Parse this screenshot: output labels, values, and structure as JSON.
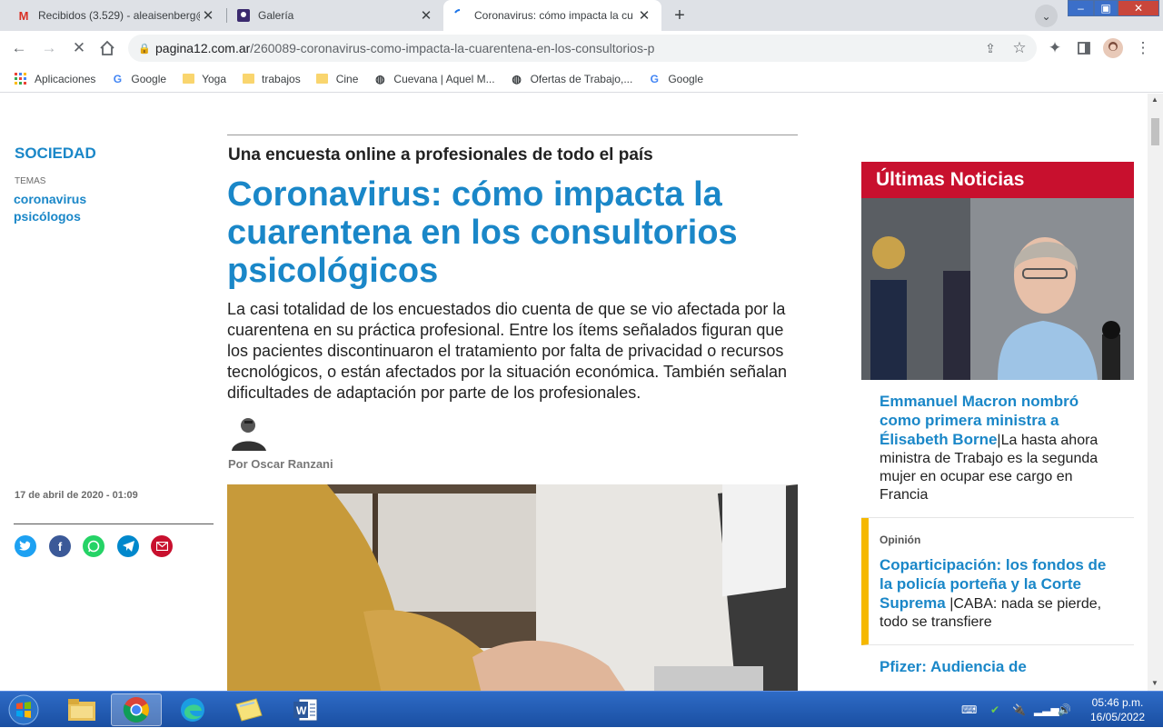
{
  "browser": {
    "tabs": [
      {
        "title": "Recibidos (3.529) - aleaisenberg@",
        "favicon": "gmail-icon"
      },
      {
        "title": "Galería",
        "favicon": "gallery-icon"
      },
      {
        "title": "Coronavirus: cómo impacta la cu",
        "favicon": "loading-icon"
      }
    ],
    "url_host": "pagina12.com.ar",
    "url_path": "/260089-coronavirus-como-impacta-la-cuarentena-en-los-consultorios-p",
    "bookmarks": [
      {
        "label": "Aplicaciones",
        "icon": "apps-grid-icon"
      },
      {
        "label": "Google",
        "icon": "google-icon"
      },
      {
        "label": "Yoga",
        "icon": "folder-icon"
      },
      {
        "label": "trabajos",
        "icon": "folder-icon"
      },
      {
        "label": "Cine",
        "icon": "folder-icon"
      },
      {
        "label": "Cuevana | Aquel M...",
        "icon": "globe-icon"
      },
      {
        "label": "Ofertas de Trabajo,...",
        "icon": "globe-icon"
      },
      {
        "label": "Google",
        "icon": "google-icon"
      }
    ]
  },
  "article": {
    "section": "SOCIEDAD",
    "temas_label": "TEMAS",
    "temas": [
      "coronavirus",
      "psicólogos"
    ],
    "date": "17 de abril de 2020 - 01:09",
    "volanta": "Una encuesta online a profesionales de todo el país",
    "title": "Coronavirus: cómo impacta la cuarentena en los consultorios psicológicos",
    "lead": "La casi totalidad de los encuestados dio cuenta de que se vio afectada por la cuarentena en su práctica profesional. Entre los ítems señalados figuran que los pacientes discontinuaron el tratamiento por falta de privacidad o recursos tecnológicos, o están afectados por la situación económica. También señalan dificultades de adaptación por parte de los profesionales.",
    "author": "Por Oscar Ranzani"
  },
  "sidebar": {
    "heading": "Últimas Noticias",
    "items": [
      {
        "kicker": "",
        "title": "Emmanuel Macron nombró como primera ministra a Élisabeth Borne",
        "sep": "|",
        "desc": "La hasta ahora ministra de Trabajo es la segunda mujer en ocupar ese cargo en Francia"
      },
      {
        "kicker": "Opinión",
        "title": "Coparticipación: los fondos de la policía porteña y la Corte Suprema",
        "sep": " |",
        "desc": "CABA: nada se pierde, todo se transfiere"
      },
      {
        "kicker": "",
        "title": "Pfizer: Audiencia de",
        "sep": "",
        "desc": ""
      }
    ]
  },
  "taskbar": {
    "time": "05:46 p.m.",
    "date": "16/05/2022"
  },
  "colors": {
    "accent": "#1a87c8",
    "breaking_red": "#c8102e",
    "opinion_yellow": "#f5b800",
    "taskbar_blue": "#1a4fa2"
  }
}
